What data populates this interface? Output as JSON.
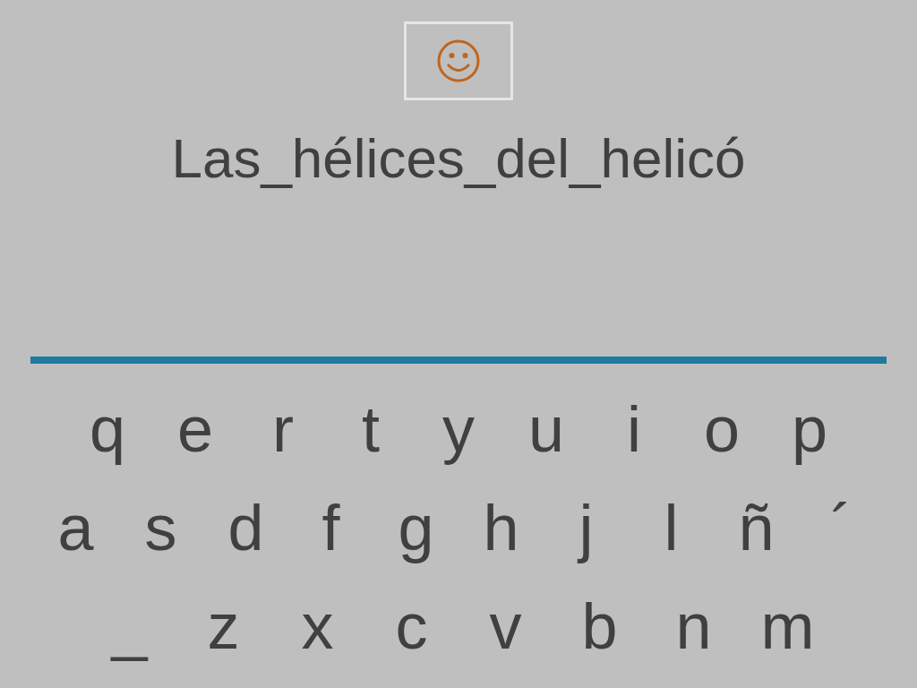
{
  "phrase": "Las_hélices_del_helicó",
  "keyboard": {
    "rows": [
      [
        "q",
        "e",
        "r",
        "t",
        "y",
        "u",
        "i",
        "o",
        "p"
      ],
      [
        "a",
        "s",
        "d",
        "f",
        "g",
        "h",
        "j",
        "l",
        "ñ",
        "´"
      ],
      [
        "_",
        "z",
        "x",
        "c",
        "v",
        "b",
        "n",
        "m"
      ]
    ]
  }
}
